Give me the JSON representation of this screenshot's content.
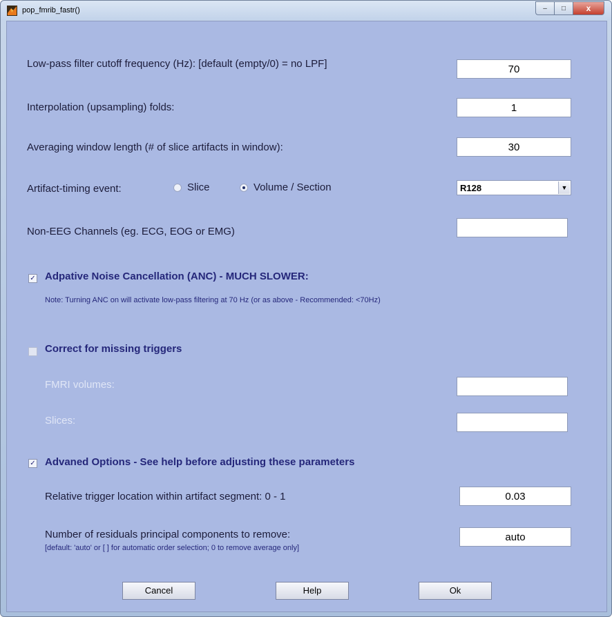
{
  "window": {
    "title": "pop_fmrib_fastr()",
    "controls": {
      "minimize": "–",
      "maximize": "□",
      "close": "x"
    }
  },
  "form": {
    "lpf": {
      "label": "Low-pass filter cutoff frequency (Hz): [default (empty/0) = no LPF]",
      "value": "70"
    },
    "interp": {
      "label": "Interpolation (upsampling) folds:",
      "value": "1"
    },
    "avg_window": {
      "label": "Averaging window length (# of slice artifacts in window):",
      "value": "30"
    },
    "timing": {
      "label": "Artifact-timing event:",
      "options": [
        "Slice",
        "Volume / Section"
      ],
      "selected": "Volume / Section",
      "event": "R128"
    },
    "non_eeg": {
      "label": "Non-EEG Channels (eg. ECG, EOG or EMG)",
      "value": ""
    },
    "anc": {
      "label": "Adpative Noise Cancellation (ANC) - MUCH SLOWER:",
      "checked": true,
      "note": "Note: Turning ANC on will activate low-pass filtering at 70 Hz (or as above - Recommended: <70Hz)"
    },
    "missing": {
      "label": "Correct for missing triggers",
      "checked": false,
      "fmri_label": "FMRI volumes:",
      "fmri_value": "",
      "slices_label": "Slices:",
      "slices_value": ""
    },
    "advanced": {
      "label": "Advaned Options - See help before adjusting these parameters",
      "checked": true,
      "trigger_label": "Relative trigger location within artifact segment: 0 - 1",
      "trigger_value": "0.03",
      "pcs_label": "Number of residuals principal components to remove:",
      "pcs_note": "[default: 'auto' or [ ] for automatic order selection; 0 to remove average only]",
      "pcs_value": "auto"
    }
  },
  "buttons": {
    "cancel": "Cancel",
    "help": "Help",
    "ok": "Ok"
  },
  "checkmark": "✓"
}
